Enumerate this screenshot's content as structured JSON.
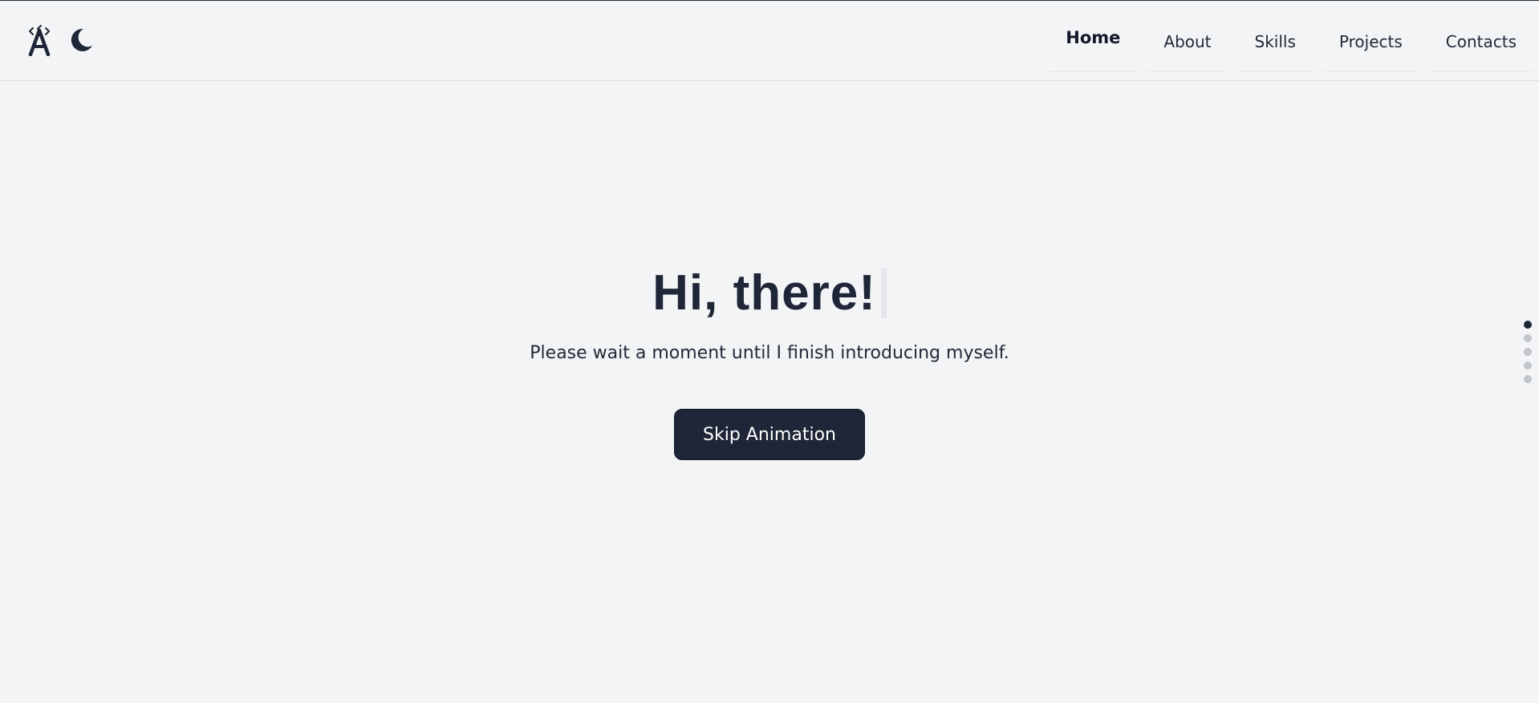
{
  "brand": {
    "logo_icon": "atom-a-logo-icon",
    "theme_icon": "moon-icon"
  },
  "nav": {
    "items": [
      {
        "label": "Home",
        "active": true
      },
      {
        "label": "About",
        "active": false
      },
      {
        "label": "Skills",
        "active": false
      },
      {
        "label": "Projects",
        "active": false
      },
      {
        "label": "Contacts",
        "active": false
      }
    ]
  },
  "hero": {
    "title": "Hi, there!",
    "subtitle": "Please wait a moment until I finish introducing myself.",
    "skip_label": "Skip Animation"
  },
  "section_nav": {
    "count": 5,
    "active_index": 0
  },
  "colors": {
    "background": "#f3f4f6",
    "primary": "#1e2638",
    "dot_inactive": "#c2c5ca"
  }
}
